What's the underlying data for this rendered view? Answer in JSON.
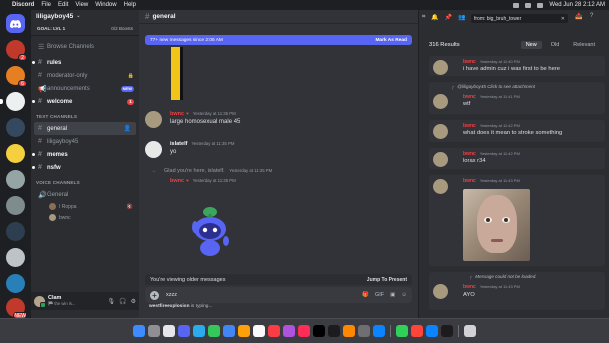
{
  "menubar": {
    "items": [
      "Discord",
      "File",
      "Edit",
      "View",
      "Window",
      "Help"
    ],
    "datetime": "Wed Jun 28  2:12 AM"
  },
  "servers": {
    "badges": [
      "2",
      "6",
      "",
      "",
      "",
      "",
      "",
      "",
      "",
      "",
      "",
      "",
      "",
      "NEW"
    ]
  },
  "guild": {
    "name": "liligayboy45",
    "goal": "GOAL: LVL 1",
    "boosts": "0/2 Boosts",
    "browse": "Browse Channels",
    "channels_top": [
      {
        "name": "rules",
        "unread": true
      },
      {
        "name": "moderator-only",
        "locked": true
      },
      {
        "name": "announcements",
        "tag": "NEW"
      },
      {
        "name": "welcome",
        "badge": "1",
        "unread": true
      }
    ],
    "text_category": "TEXT CHANNELS",
    "text_channels": [
      "general",
      "liligayboy45",
      "memes",
      "nsfw"
    ],
    "voice_category": "VOICE CHANNELS",
    "voice_channel": "General",
    "voice_users": [
      "I Roppa",
      "bwnc"
    ]
  },
  "user": {
    "name": "Clam",
    "status": "🏁 the win is..."
  },
  "chat": {
    "channel": "general",
    "new_messages": "77+ new messages since 2:06 AM",
    "mark_as_read": "Mark As Read",
    "messages": [
      {
        "author": "bwnc",
        "time": "Yesterday at 11:35 PM",
        "text": "large homosexual male 45"
      },
      {
        "author": "islatelf",
        "time": "Yesterday at 11:35 PM",
        "text": "yo"
      }
    ],
    "system": {
      "text": "Glad you're here, islatelf.",
      "time": "Yesterday at 11:35 PM"
    },
    "sticker_msg": {
      "author": "bwnc",
      "time": "Yesterday at 11:35 PM"
    },
    "older_notice": "You're viewing older messages",
    "jump": "Jump To Present",
    "composer_text": "xzzz",
    "typing_user": "westfireexplosion",
    "typing_suffix": " is typing..."
  },
  "search": {
    "query": "from: big_bruh_tower",
    "count": "316 Results",
    "tabs": [
      "New",
      "Old",
      "Relevant"
    ],
    "results": [
      {
        "author": "bwnc",
        "time": "Yesterday at 11:40 PM",
        "text": "i have admin cuz i was first to be here"
      },
      {
        "author": "bwnc",
        "time": "Yesterday at 11:41 PM",
        "reply": "@liligayboy45 Click to see attachment",
        "text": "wtf"
      },
      {
        "author": "bwnc",
        "time": "Yesterday at 11:42 PM",
        "text": "what does it mean to stroke something"
      },
      {
        "author": "bwnc",
        "time": "Yesterday at 11:42 PM",
        "text": "lorax r34"
      },
      {
        "author": "bwnc",
        "time": "Yesterday at 11:43 PM",
        "text": ""
      },
      {
        "author": "bwnc",
        "time": "Yesterday at 11:43 PM",
        "reply": "Message could not be loaded.",
        "text": "AYO"
      }
    ]
  },
  "colors": {
    "blurple": "#5865f2",
    "red": "#f23f43",
    "green": "#23a55a",
    "background": "#313338"
  }
}
